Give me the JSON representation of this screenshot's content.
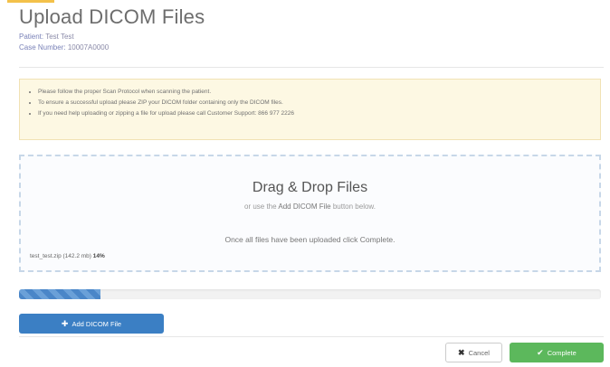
{
  "page": {
    "title": "Upload DICOM Files",
    "patient_label": "Patient:",
    "patient_value": "Test Test",
    "case_label": "Case Number:",
    "case_value": "10007A0000"
  },
  "alert": {
    "items": [
      "Please follow the proper Scan Protocol when scanning the patient.",
      "To ensure a successful upload please ZIP your DICOM folder containing only the DICOM files.",
      "If you need help uploading or zipping a file for upload please call Customer Support: 866 977 2226"
    ]
  },
  "dropzone": {
    "title": "Drag & Drop Files",
    "sub_prefix": "or use the",
    "sub_button_ref": "Add DICOM File",
    "sub_suffix": "button below.",
    "hint": "Once all files have been uploaded click Complete.",
    "file_name": "test_test.zip",
    "file_size": "(142.2 mb)",
    "file_percent": "14%"
  },
  "progress": {
    "value_percent": 14
  },
  "buttons": {
    "add_label": "Add DICOM File",
    "cancel_label": "Cancel",
    "complete_label": "Complete"
  },
  "icons": {
    "add": "plus-circle-icon",
    "cancel": "close-icon",
    "complete": "check-icon"
  },
  "colors": {
    "primary": "#3b7fc4",
    "success": "#5cb85c",
    "warning_bg": "#fdf8e3"
  }
}
